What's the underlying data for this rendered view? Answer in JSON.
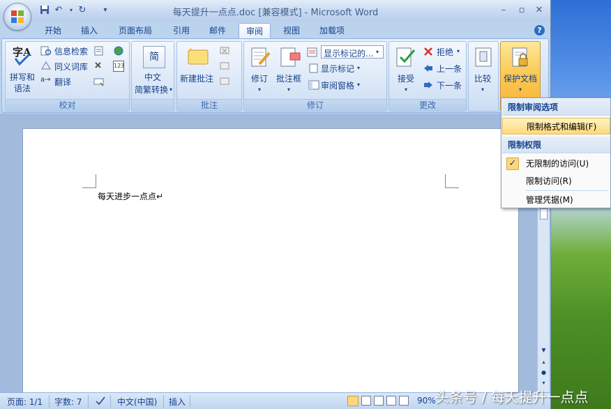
{
  "window": {
    "title": "每天提升一点点.doc [兼容模式] - Microsoft Word",
    "minimize": "–",
    "restore": "▫",
    "close": "✕"
  },
  "tabs": [
    {
      "label": "开始"
    },
    {
      "label": "插入"
    },
    {
      "label": "页面布局"
    },
    {
      "label": "引用"
    },
    {
      "label": "邮件"
    },
    {
      "label": "审阅"
    },
    {
      "label": "视图"
    },
    {
      "label": "加载项"
    }
  ],
  "help": "?",
  "groups": {
    "proofing": {
      "label": "校对",
      "spelling_line1": "拼写和",
      "spelling_line2": "语法",
      "research": "信息检索",
      "thesaurus": "同义词库",
      "translate": "翻译"
    },
    "chinese": {
      "label": "",
      "button_line1": "中文",
      "button_line2": "简繁转换",
      "icon_char": "简"
    },
    "comments": {
      "label": "批注",
      "new_comment": "新建批注"
    },
    "tracking": {
      "label": "修订",
      "track_changes": "修订",
      "balloons": "批注框",
      "markup_select": "显示标记的...",
      "show_markup": "显示标记",
      "reviewing_pane": "审阅窗格"
    },
    "changes": {
      "label": "更改",
      "accept": "接受",
      "reject": "拒绝",
      "previous": "上一条",
      "next": "下一条"
    },
    "compare": {
      "compare": "比较"
    },
    "protect": {
      "protect_doc": "保护文档"
    }
  },
  "dropdown": {
    "section1": "限制审阅选项",
    "item_restrict_format": "限制格式和编辑(F)",
    "section2": "限制权限",
    "item_unrestricted": "无限制的访问(U)",
    "item_restricted": "限制访问(R)",
    "item_manage": "管理凭据(M)",
    "check": "✓"
  },
  "document": {
    "text": "每天进步一点点↵"
  },
  "status": {
    "page": "页面: 1/1",
    "words": "字数: 7",
    "language": "中文(中国)",
    "mode": "插入",
    "zoom": "90%"
  },
  "watermark": "头条号 / 每天提升一点点"
}
